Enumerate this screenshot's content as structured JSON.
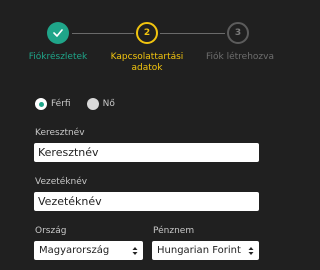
{
  "stepper": {
    "steps": [
      {
        "number": "",
        "label": "Fiókrészletek",
        "state": "complete",
        "icon": "check-icon"
      },
      {
        "number": "2",
        "label": "Kapcsolattartási adatok",
        "state": "active"
      },
      {
        "number": "3",
        "label": "Fiók létrehozva",
        "state": "pending"
      }
    ]
  },
  "gender": {
    "options": [
      {
        "label": "Férfi",
        "selected": true
      },
      {
        "label": "Nő",
        "selected": false
      }
    ]
  },
  "first_name": {
    "label": "Keresztnév",
    "value": "Keresztnév"
  },
  "last_name": {
    "label": "Vezetéknév",
    "value": "Vezetéknév"
  },
  "country": {
    "label": "Ország",
    "value": "Magyarország"
  },
  "currency": {
    "label": "Pénznem",
    "value": "Hungarian Forint"
  },
  "colors": {
    "background": "#202020",
    "complete": "#1fa589",
    "active": "#f1c40f",
    "pending": "#6e6e6e"
  }
}
